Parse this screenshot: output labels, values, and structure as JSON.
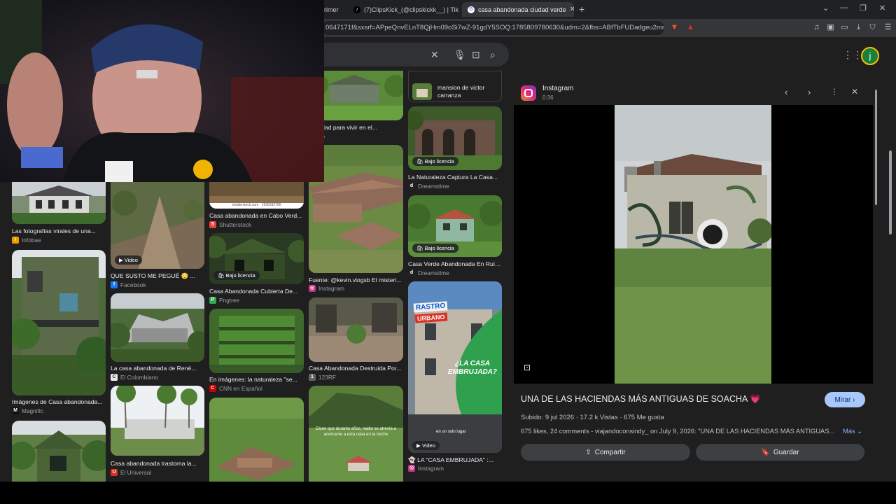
{
  "tabs": [
    {
      "label": "rimer",
      "fav_color": "#9aa0a6"
    },
    {
      "label": "(7)ClipsKick_(@clipskickk__) | TikTok",
      "fav_color": "#000000"
    },
    {
      "label": "casa abandonada ciudad verde",
      "fav_color": "#ffffff"
    }
  ],
  "address": {
    "url": "0647171f&sxsrf=APpeQnvELnT8QjHm09oSi7wZ-91gdY5SOQ:1785809780630&udm=2&fbs=ABfTbFUDadgeu2mn..."
  },
  "avatar_letter": "j",
  "results": [
    {
      "title": "Las fotografías virales de una...",
      "source": "Infobae",
      "src_color": "#f29900",
      "src_letter": "i"
    },
    {
      "title": "Imágenes de Casa abandonada...",
      "source": "Magnific",
      "src_color": "#111111",
      "src_letter": "M"
    },
    {
      "title": "QUE SUSTO ME PEGUÉ 😳 ...",
      "source": "Facebook",
      "src_color": "#1877f2",
      "src_letter": "f",
      "badge": "▶ Video"
    },
    {
      "title": "La casa abandonada de René...",
      "source": "El Colombiano",
      "src_color": "#e8eaed",
      "src_letter": "C"
    },
    {
      "title": "Casa abandonada trastorna la...",
      "source": "El Universal",
      "src_color": "#d93025",
      "src_letter": "U"
    },
    {
      "title": "Casa abandonada en Cabo Verd...",
      "source": "Shutterstock",
      "src_color": "#ea4335",
      "src_letter": "S"
    },
    {
      "title": "Casa Abandonada Cubierta De...",
      "source": "Pngtree",
      "src_color": "#34a853",
      "src_letter": "P",
      "badge": "🛍 Bajo licencia"
    },
    {
      "title": "En imágenes: la naturaleza \"se...",
      "source": "CNN en Español",
      "src_color": "#cc0000",
      "src_letter": "C"
    },
    {
      "title": "a ciudad para vivir en el...",
      "source": "uTube",
      "src_color": "#ff0000",
      "src_letter": "▶"
    },
    {
      "title": "Fuente: @kevin.vlogsb El misteri...",
      "source": "Instagram",
      "src_color": "#c13584",
      "src_letter": "◎"
    },
    {
      "title": "Casa Abandonada Destruida Por...",
      "source": "123RF",
      "src_color": "#5f6368",
      "src_letter": "1"
    },
    {
      "title": "mansion de victor carranza",
      "title2": "carranza",
      "source": "",
      "src_color": "#5f6368",
      "src_letter": ""
    },
    {
      "title": "La Naturaleza Captura La Casa...",
      "source": "Dreamstime",
      "src_color": "#202124",
      "src_letter": "d",
      "badge": "🛍 Bajo licencia"
    },
    {
      "title": "Casa Verde Abandonada En Ruin...",
      "source": "Dreamstime",
      "src_color": "#202124",
      "src_letter": "d",
      "badge": "🛍 Bajo licencia"
    },
    {
      "title": "👻 LA \"CASA EMBRUJADA\" :...",
      "source": "Instagram",
      "src_color": "#c13584",
      "src_letter": "◎",
      "badge": "▶ Video"
    }
  ],
  "thumb_text": {
    "shutter": "shutterstock.com · 1935932780",
    "rastro": "RASTRO",
    "urbano": "URBANO",
    "casa_embrujada": "¿LA CASA EMBRUJADA?",
    "en_un_solo_lugar": "en un solo lugar",
    "dicen": "Dicen que durante años, nadie se atrevía a acercarse a esta casa en la noche"
  },
  "panel": {
    "site": "Instagram",
    "duration": "0:36",
    "title": "UNA DE LAS HACIENDAS MÁS ANTIGUAS DE SOACHA 💗",
    "mirar": "Mirar",
    "meta": "Subido: 9 jul 2026 · 17.2 k Vistas · 675 Me gusta",
    "desc": "675 likes, 24 comments - viajandoconsindy_ on July 9, 2026: \"UNA DE LAS HACIENDAS MÁS ANTIGUAS...",
    "more": "Más",
    "share": "Compartir",
    "save": "Guardar"
  }
}
